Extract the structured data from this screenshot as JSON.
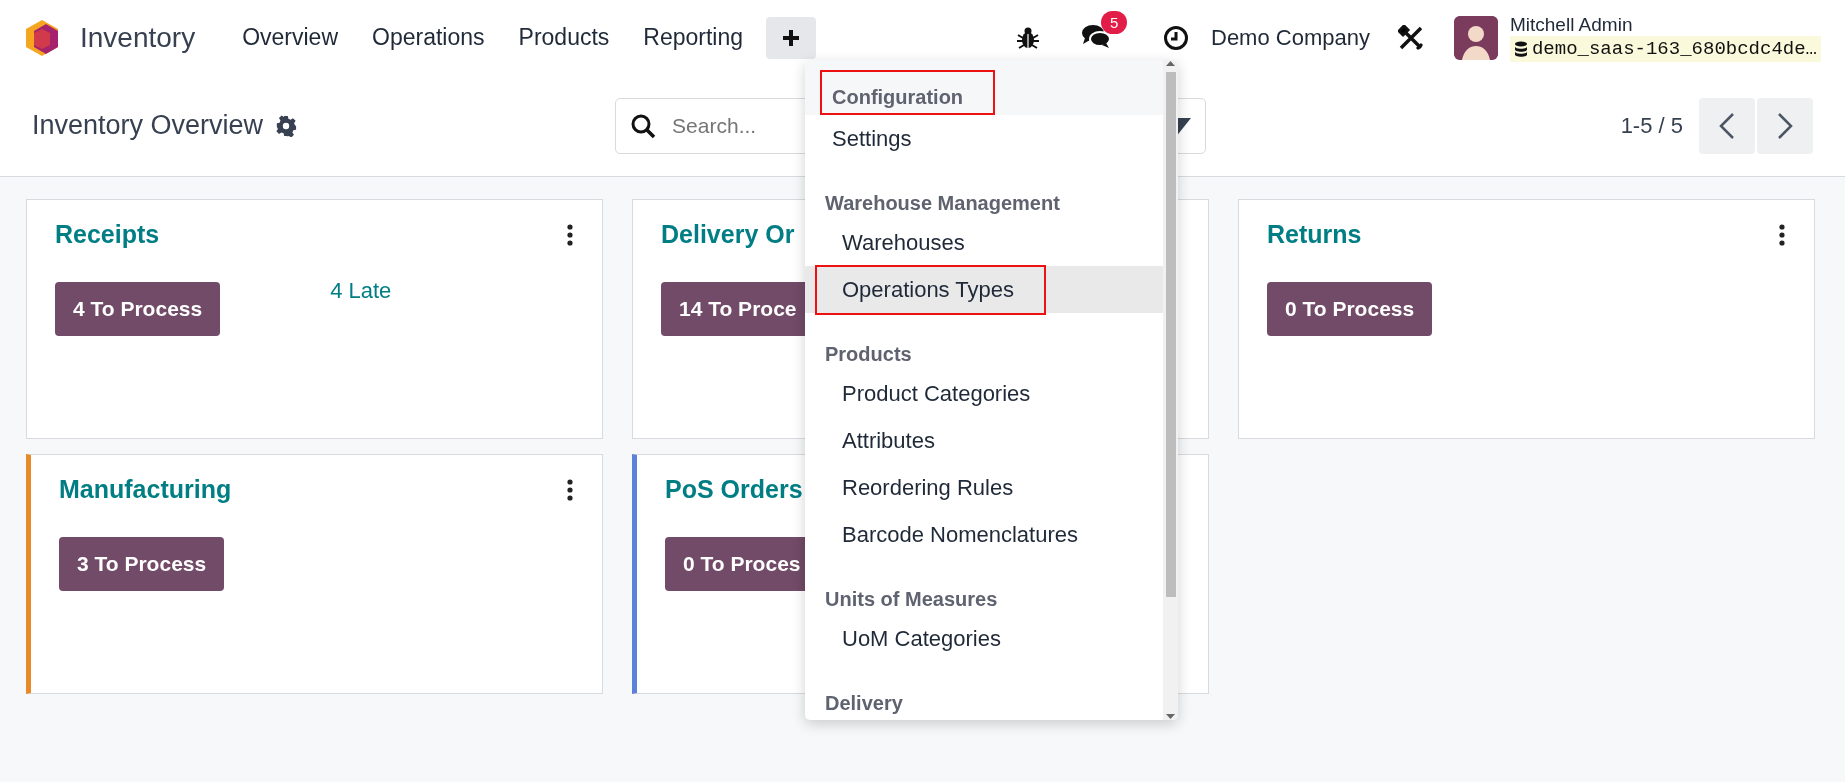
{
  "topbar": {
    "app_name": "Inventory",
    "menus": [
      {
        "label": "Overview"
      },
      {
        "label": "Operations"
      },
      {
        "label": "Products"
      },
      {
        "label": "Reporting"
      }
    ],
    "plus_button": {
      "expanded": true
    },
    "messages_badge": "5",
    "company": "Demo Company",
    "user": {
      "name": "Mitchell Admin",
      "database": "demo_saas-163_680bcdc4de…"
    }
  },
  "control_panel": {
    "title": "Inventory Overview",
    "search": {
      "placeholder": "Search..."
    },
    "pager": "1-5 / 5"
  },
  "cards": [
    {
      "title": "Receipts",
      "button": "4 To Process",
      "late": "4 Late",
      "menu": true
    },
    {
      "title": "Delivery Or",
      "button": "14 To Proce",
      "menu": false
    },
    {
      "title": "Returns",
      "button": "0 To Process",
      "menu": true
    },
    {
      "title": "Manufacturing",
      "button": "3 To Process",
      "menu": true,
      "color": "#e8892a"
    },
    {
      "title": "PoS Orders",
      "button": "0 To Proces",
      "menu": false,
      "color": "#5b82d8"
    }
  ],
  "dropdown": {
    "items": [
      {
        "kind": "header",
        "label": "Configuration",
        "highlighted": true
      },
      {
        "kind": "item",
        "label": "Settings",
        "highlighted": false,
        "selected": false
      },
      {
        "kind": "header",
        "label": "Warehouse Management",
        "highlighted": false
      },
      {
        "kind": "subitem",
        "label": "Warehouses",
        "highlighted": false,
        "selected": false
      },
      {
        "kind": "subitem",
        "label": "Operations Types",
        "highlighted": true,
        "selected": true
      },
      {
        "kind": "header",
        "label": "Products",
        "highlighted": false
      },
      {
        "kind": "subitem",
        "label": "Product Categories",
        "highlighted": false,
        "selected": false
      },
      {
        "kind": "subitem",
        "label": "Attributes",
        "highlighted": false,
        "selected": false
      },
      {
        "kind": "subitem",
        "label": "Reordering Rules",
        "highlighted": false,
        "selected": false
      },
      {
        "kind": "subitem",
        "label": "Barcode Nomenclatures",
        "highlighted": false,
        "selected": false
      },
      {
        "kind": "header",
        "label": "Units of Measures",
        "highlighted": false
      },
      {
        "kind": "subitem",
        "label": "UoM Categories",
        "highlighted": false,
        "selected": false
      },
      {
        "kind": "header",
        "label": "Delivery",
        "highlighted": false
      }
    ]
  }
}
